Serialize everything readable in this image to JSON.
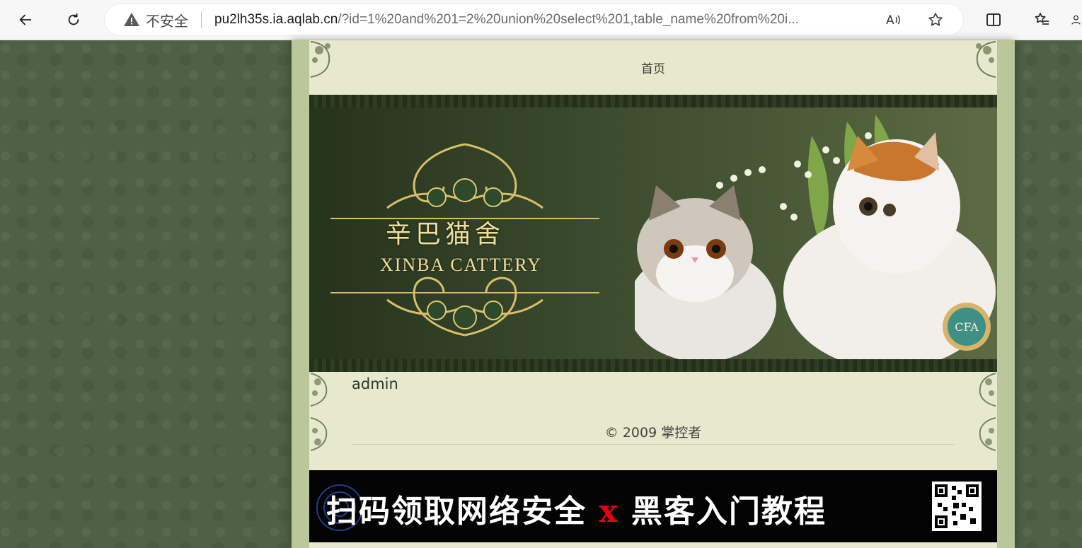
{
  "browser": {
    "security_label": "不安全",
    "url_host": "pu2lh35s.ia.aqlab.cn",
    "url_path": "/?id=1%20and%201=2%20union%20select%201,table_name%20from%20i...",
    "icons": [
      "back-icon",
      "refresh-icon",
      "warning-icon",
      "read-aloud-icon",
      "favorite-star-icon",
      "split-screen-icon",
      "favorites-list-icon"
    ]
  },
  "site": {
    "nav_home": "首页",
    "banner": {
      "logo_cn": "辛巴猫舍",
      "logo_en": "XINBA CATTERY",
      "badge_text": "CFA"
    },
    "result_value": "admin",
    "footer": "© 2009 掌控者",
    "ad": {
      "text_left": "扫码领取网络安全",
      "x": "x",
      "text_right": "黑客入门教程"
    }
  },
  "colors": {
    "page_bg": "#4f6044",
    "frame": "#b9c79a",
    "paper": "#e7e9cd",
    "banner_gold": "#f0df9a",
    "ad_red": "#e60012"
  }
}
